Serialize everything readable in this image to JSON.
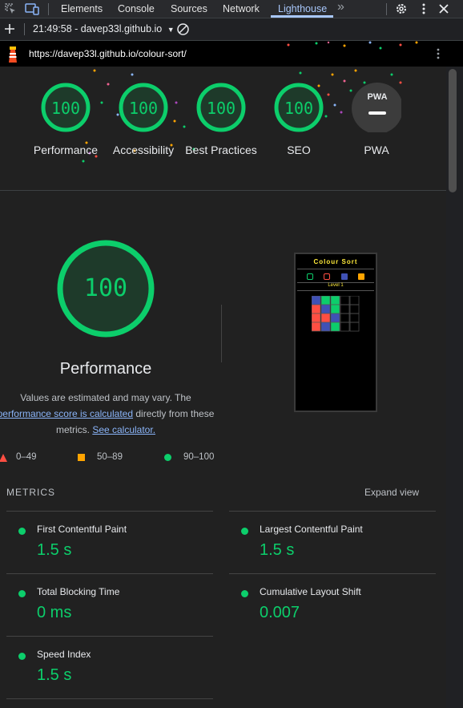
{
  "devtools": {
    "tabs": [
      "Elements",
      "Console",
      "Sources",
      "Network",
      "Lighthouse"
    ],
    "active_tab": "Lighthouse",
    "more_tabs_glyph": "»",
    "report_selector": "21:49:58 - davep33l.github.io",
    "url": "https://davep33l.github.io/colour-sort/"
  },
  "categories": [
    {
      "score": "100",
      "label": "Performance"
    },
    {
      "score": "100",
      "label": "Accessibility"
    },
    {
      "score": "100",
      "label": "Best Practices"
    },
    {
      "score": "100",
      "label": "SEO"
    },
    {
      "score": "",
      "label": "PWA",
      "badge": "PWA"
    }
  ],
  "performance": {
    "score": "100",
    "title": "Performance",
    "desc_1": "Values are estimated and may vary. The",
    "link_1": "performance score is calculated",
    "desc_2": "directly from these",
    "desc_3": "metrics.",
    "link_2": "See calculator."
  },
  "legend": [
    {
      "range": "0–49",
      "color": "#ff4e42"
    },
    {
      "range": "50–89",
      "color": "#ffa400"
    },
    {
      "range": "90–100",
      "color": "#0cce6b"
    }
  ],
  "preview": {
    "app_title": "Colour Sort",
    "level": "Level 1"
  },
  "metrics": {
    "header": "METRICS",
    "expand": "Expand view",
    "items": [
      {
        "name": "First Contentful Paint",
        "value": "1.5 s"
      },
      {
        "name": "Largest Contentful Paint",
        "value": "1.5 s"
      },
      {
        "name": "Total Blocking Time",
        "value": "0 ms"
      },
      {
        "name": "Cumulative Layout Shift",
        "value": "0.007"
      },
      {
        "name": "Speed Index",
        "value": "1.5 s"
      }
    ]
  },
  "colors": {
    "pass": "#0cce6b",
    "pass_bg": "#1e3a2a",
    "link": "#8ab4f8"
  }
}
